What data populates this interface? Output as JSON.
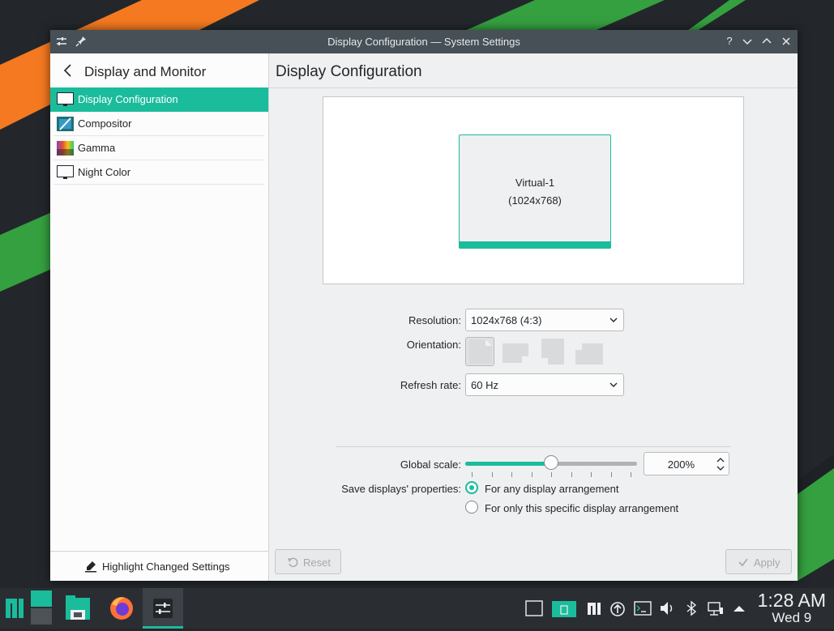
{
  "window": {
    "title": "Display Configuration — System Settings",
    "help_label": "?"
  },
  "sidebar": {
    "header": "Display and Monitor",
    "items": [
      {
        "label": "Display Configuration",
        "icon": "monitor-icon",
        "selected": true
      },
      {
        "label": "Compositor",
        "icon": "compositor-icon",
        "selected": false
      },
      {
        "label": "Gamma",
        "icon": "gamma-icon",
        "selected": false
      },
      {
        "label": "Night Color",
        "icon": "night-color-icon",
        "selected": false
      }
    ],
    "footer": "Highlight Changed Settings"
  },
  "main": {
    "title": "Display Configuration",
    "output": {
      "name": "Virtual-1",
      "resolution": "(1024x768)"
    },
    "resolution_label": "Resolution:",
    "resolution_value": "1024x768 (4:3)",
    "orientation_label": "Orientation:",
    "orientation_options": [
      "normal",
      "rotate-left",
      "upside-down",
      "rotate-right"
    ],
    "orientation_selected": "normal",
    "refresh_label": "Refresh rate:",
    "refresh_value": "60 Hz",
    "scale_label": "Global scale:",
    "scale_value": "200%",
    "scale_slider_fraction": 0.5,
    "save_label": "Save displays' properties:",
    "save_options": [
      {
        "label": "For any display arrangement",
        "checked": true
      },
      {
        "label": "For only this specific display arrangement",
        "checked": false
      }
    ],
    "reset_label": "Reset",
    "apply_label": "Apply"
  },
  "taskbar": {
    "time": "1:28 AM",
    "date": "Wed 9"
  },
  "colors": {
    "accent": "#1abc9c",
    "titlebar": "#475057",
    "panel": "#2a2e32",
    "desktop_orange": "#f47920",
    "desktop_green": "#35a03f"
  }
}
